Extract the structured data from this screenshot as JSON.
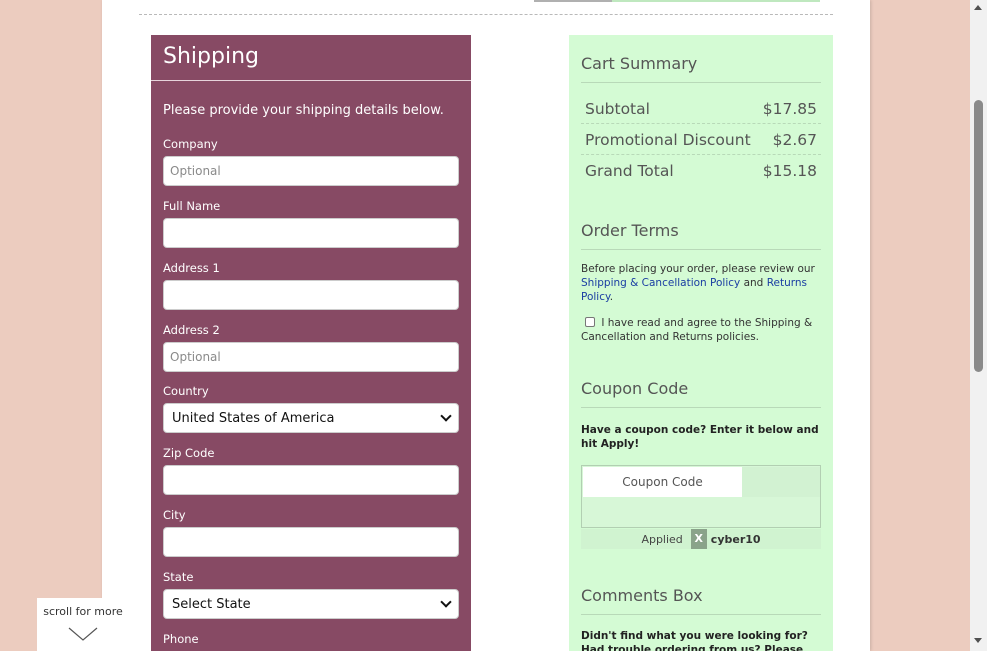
{
  "shipping": {
    "title": "Shipping",
    "intro": "Please provide your shipping details below.",
    "fields": {
      "company": {
        "label": "Company",
        "placeholder": "Optional"
      },
      "full_name": {
        "label": "Full Name",
        "placeholder": ""
      },
      "address1": {
        "label": "Address 1",
        "placeholder": ""
      },
      "address2": {
        "label": "Address 2",
        "placeholder": "Optional"
      },
      "country": {
        "label": "Country",
        "value": "United States of America"
      },
      "zip": {
        "label": "Zip Code",
        "placeholder": ""
      },
      "city": {
        "label": "City",
        "placeholder": ""
      },
      "state": {
        "label": "State",
        "value": "Select State"
      },
      "phone": {
        "label": "Phone"
      }
    }
  },
  "cart_summary": {
    "title": "Cart Summary",
    "rows": [
      {
        "label": "Subtotal",
        "value": "$17.85"
      },
      {
        "label": "Promotional Discount",
        "value": "$2.67"
      },
      {
        "label": "Grand Total",
        "value": "$15.18"
      }
    ]
  },
  "order_terms": {
    "title": "Order Terms",
    "intro": "Before placing your order, please review our",
    "link1": "Shipping & Cancellation Policy",
    "and": "and",
    "link2": "Returns Policy",
    "period": ".",
    "agree_text": "I have read and agree to the Shipping & Cancellation and Returns policies."
  },
  "coupon": {
    "title": "Coupon Code",
    "prompt": "Have a coupon code? Enter it below and hit Apply!",
    "placeholder": "Coupon Code",
    "applied_label": "Applied",
    "remove_label": "X",
    "applied_code": "cyber10"
  },
  "comments": {
    "title": "Comments Box",
    "prompt": "Didn't find what you were looking for? Had trouble ordering from us? Please tell us so we"
  },
  "scroll_hint": {
    "text": "scroll for more"
  },
  "colors": {
    "background": "#ecccbf",
    "shipping_panel": "#874a64",
    "summary_panel": "#d4fbd4",
    "link": "#1a3da3"
  }
}
